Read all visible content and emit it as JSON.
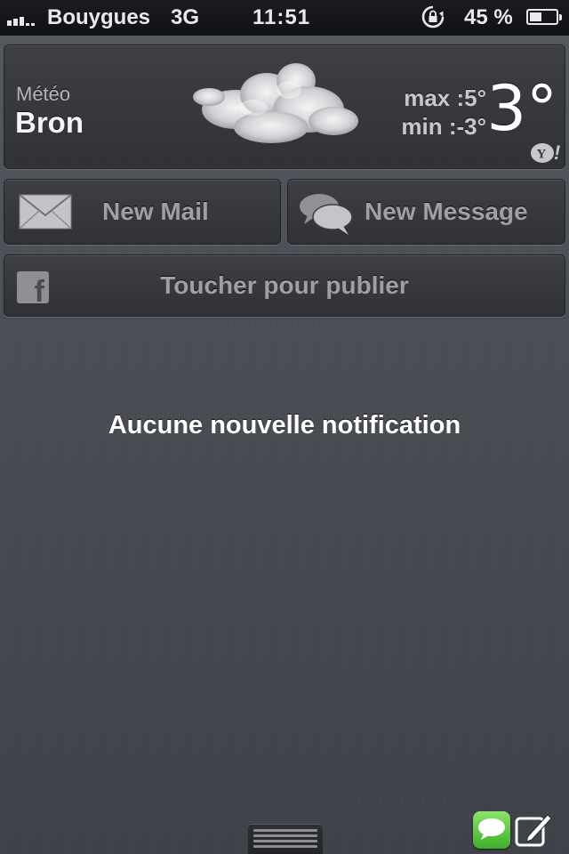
{
  "status_bar": {
    "carrier": "Bouygues",
    "network": "3G",
    "time": "11:51",
    "battery_text": "45 %",
    "battery_level": 0.45,
    "signal_icon": "signal-bars-icon",
    "rotation_lock_icon": "rotation-lock-icon",
    "battery_icon": "battery-icon"
  },
  "weather_widget": {
    "label": "Météo",
    "city": "Bron",
    "max": "max :5°",
    "min": "min :-3°",
    "temperature": "3°",
    "condition_icon": "cloud-icon",
    "provider_icon": "yahoo-icon"
  },
  "share_widget": {
    "mail_label": "New Mail",
    "message_label": "New Message",
    "facebook_label": "Toucher pour publier",
    "mail_icon": "envelope-icon",
    "message_icon": "speech-bubbles-icon",
    "facebook_icon": "facebook-icon"
  },
  "notifications": {
    "empty_text": "Aucune nouvelle notification"
  },
  "dock": {
    "handle_icon": "grab-handle-icon",
    "messages_icon": "messages-app-icon",
    "compose_icon": "compose-icon"
  },
  "colors": {
    "background": "#4a4d54",
    "status_bar": "#101114",
    "button_text": "#9ea0a6",
    "messages_green": "#3fae2a"
  }
}
